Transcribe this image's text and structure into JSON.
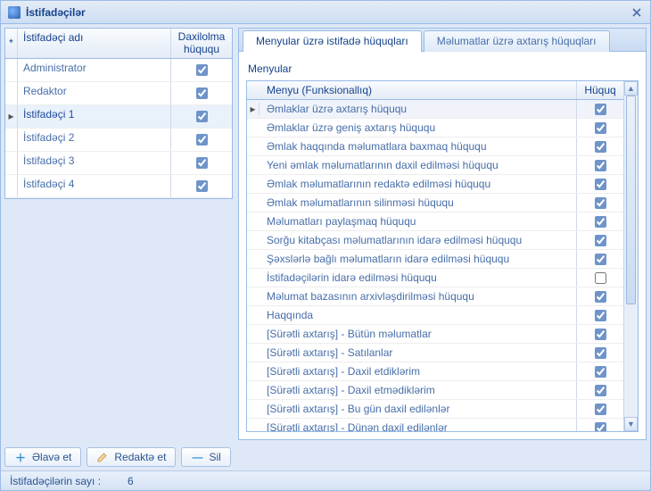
{
  "window": {
    "title": "İstifadəçilər"
  },
  "users": {
    "columns": {
      "name": "İstifadəçi adı",
      "login": "Daxilolma hüququ"
    },
    "rows": [
      {
        "name": "Administrator",
        "login": true,
        "selected": false
      },
      {
        "name": "Redaktor",
        "login": true,
        "selected": false
      },
      {
        "name": "İstifadəçi 1",
        "login": true,
        "selected": true
      },
      {
        "name": "İstifadəçi 2",
        "login": true,
        "selected": false
      },
      {
        "name": "İstifadəçi 3",
        "login": true,
        "selected": false
      },
      {
        "name": "İstifadəçi 4",
        "login": true,
        "selected": false
      }
    ]
  },
  "tabs": {
    "t1": "Menyular üzrə istifadə hüquqları",
    "t2": "Məlumatlar üzrə axtarış hüquqları",
    "activeIndex": 0
  },
  "permissions": {
    "section": "Menyular",
    "columns": {
      "menu": "Menyu (Funksionallıq)",
      "perm": "Hüquq"
    },
    "rows": [
      {
        "label": "Əmlaklar üzrə axtarış hüququ",
        "checked": true,
        "selected": true
      },
      {
        "label": "Əmlaklar üzrə geniş axtarış hüququ",
        "checked": true,
        "selected": false
      },
      {
        "label": "Əmlak haqqında məlumatlara baxmaq hüququ",
        "checked": true,
        "selected": false
      },
      {
        "label": "Yeni əmlak məlumatlarının daxil edilməsi hüququ",
        "checked": true,
        "selected": false
      },
      {
        "label": "Əmlak məlumatlarının redaktə edilməsi hüququ",
        "checked": true,
        "selected": false
      },
      {
        "label": "Əmlak məlumatlarının silinməsi hüququ",
        "checked": true,
        "selected": false
      },
      {
        "label": "Məlumatları paylaşmaq hüququ",
        "checked": true,
        "selected": false
      },
      {
        "label": "Sorğu kitabçası məlumatlarının idarə edilməsi hüququ",
        "checked": true,
        "selected": false
      },
      {
        "label": "Şəxslərlə bağlı məlumatların idarə edilməsi hüququ",
        "checked": true,
        "selected": false
      },
      {
        "label": "İstifadəçilərin idarə edilməsi hüququ",
        "checked": false,
        "selected": false
      },
      {
        "label": "Məlumat bazasının arxivləşdirilməsi hüququ",
        "checked": true,
        "selected": false
      },
      {
        "label": "Haqqında",
        "checked": true,
        "selected": false
      },
      {
        "label": "[Sürətli axtarış] - Bütün məlumatlar",
        "checked": true,
        "selected": false
      },
      {
        "label": "[Sürətli axtarış] - Satılanlar",
        "checked": true,
        "selected": false
      },
      {
        "label": "[Sürətli axtarış] - Daxil etdiklərim",
        "checked": true,
        "selected": false
      },
      {
        "label": "[Sürətli axtarış] - Daxil etmədiklərim",
        "checked": true,
        "selected": false
      },
      {
        "label": "[Sürətli axtarış] - Bu gün daxil edilənlər",
        "checked": true,
        "selected": false
      },
      {
        "label": "[Sürətli axtarış] - Dünən daxil edilənlər",
        "checked": true,
        "selected": false
      }
    ]
  },
  "toolbar": {
    "add": "Əlavə et",
    "edit": "Redaktə et",
    "delete": "Sil"
  },
  "status": {
    "label": "İstifadəçilərin sayı :",
    "value": "6"
  }
}
